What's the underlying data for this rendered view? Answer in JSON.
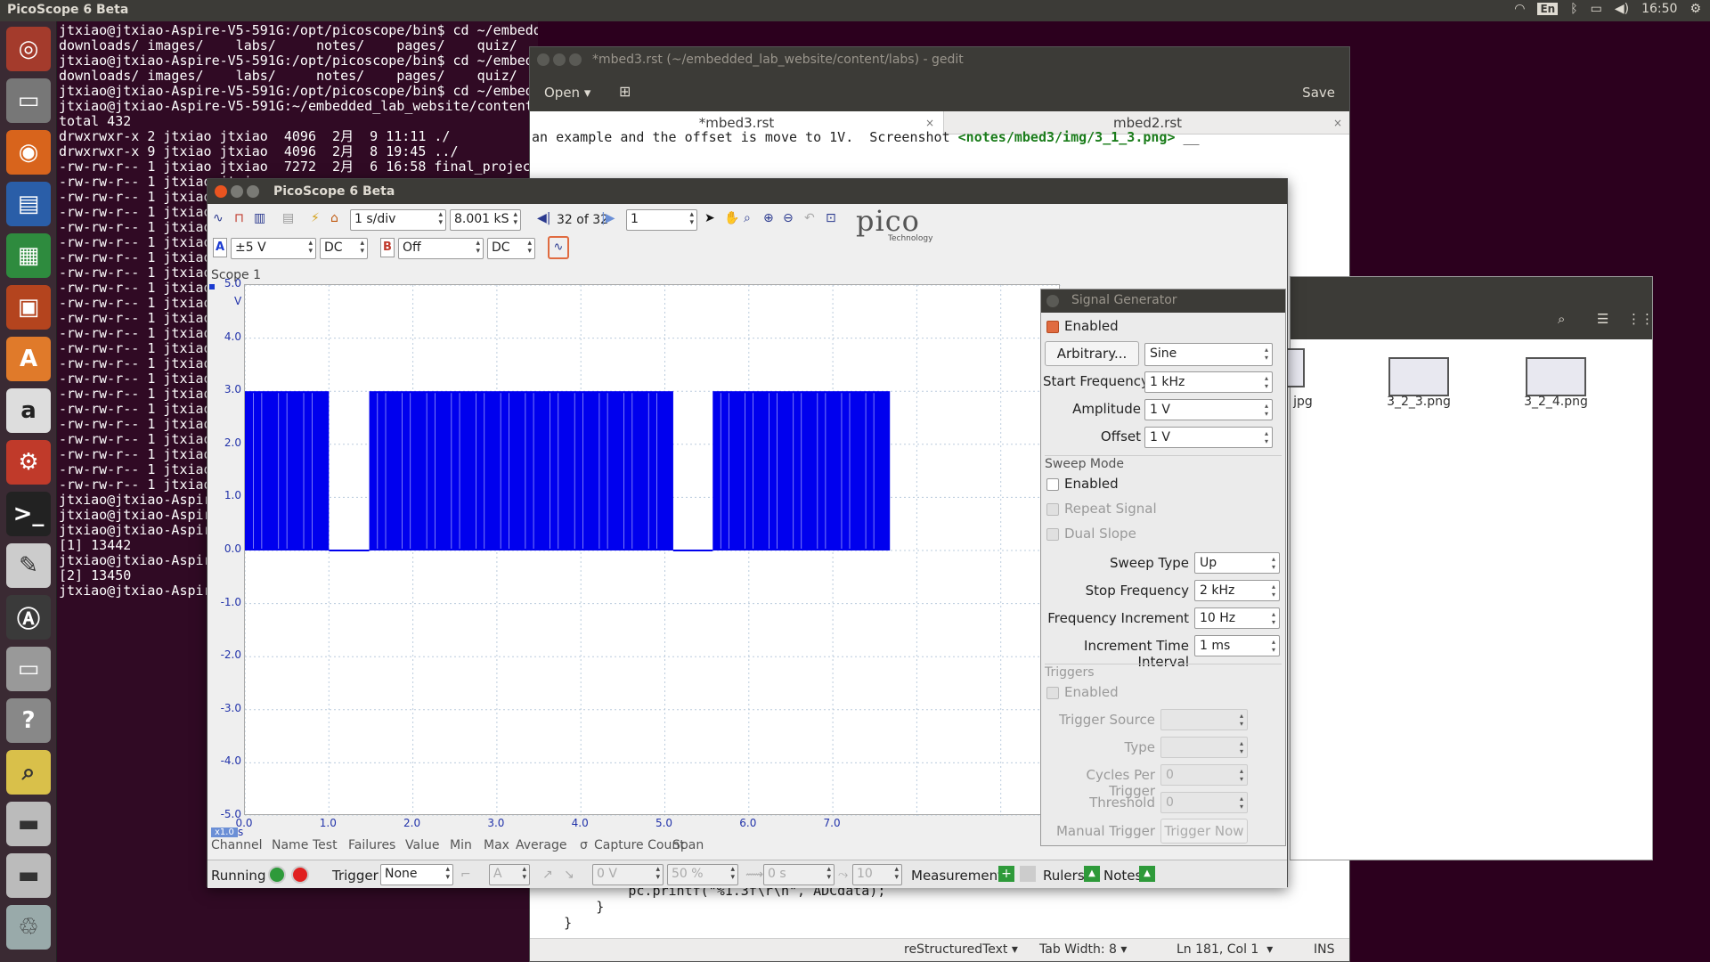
{
  "top_panel": {
    "title": "PicoScope 6 Beta",
    "keyboard": "En",
    "clock": "16:50"
  },
  "terminal": {
    "lines": [
      "jtxiao@jtxiao-Aspire-V5-591G:/opt/picoscope/bin$ cd ~/embedded_lab_website/content/",
      "downloads/ images/    labs/     notes/    pages/    quiz/     quiz_bank/",
      "jtxiao@jtxiao-Aspire-V5-591G:/opt/picoscope/bin$ cd ~/embedded_lab_website/content/",
      "downloads/ images/    labs/     notes/    pages/    quiz/",
      "jtxiao@jtxiao-Aspire-V5-591G:/opt/picoscope/bin$ cd ~/embedded_lab_website/content/labs/",
      "jtxiao@jtxiao-Aspire-V5-591G:~/embedded_lab_website/content/labs$ ls -l",
      "total 432",
      "drwxrwxr-x 2 jtxiao jtxiao  4096  2月  9 11:11 ./",
      "drwxrwxr-x 9 jtxiao jtxiao  4096  2月  8 19:45 ../",
      "-rw-rw-r-- 1 jtxiao jtxiao  7272  2月  6 16:58 final_project.rst",
      "-rw-rw-r-- 1 jtxiao jtxiao",
      "-rw-rw-r-- 1 jtxiao jtxiao",
      "-rw-rw-r-- 1 jtxiao jtxiao",
      "-rw-rw-r-- 1 jtxiao jtxiao",
      "-rw-rw-r-- 1 jtxiao jtxiao",
      "-rw-rw-r-- 1 jtxiao jtxiao",
      "-rw-rw-r-- 1 jtxiao jtxiao",
      "-rw-rw-r-- 1 jtxiao jtxiao",
      "-rw-rw-r-- 1 jtxiao jtxiao",
      "-rw-rw-r-- 1 jtxiao jtxiao",
      "-rw-rw-r-- 1 jtxiao jtxiao",
      "-rw-rw-r-- 1 jtxiao jtxiao",
      "-rw-rw-r-- 1 jtxiao jtxiao",
      "-rw-rw-r-- 1 jtxiao jtxiao",
      "-rw-rw-r-- 1 jtxiao jtxiao",
      "-rw-rw-r-- 1 jtxiao jtxiao",
      "-rw-rw-r-- 1 jtxiao jtxiao",
      "-rw-rw-r-- 1 jtxiao jtxiao",
      "-rw-rw-r-- 1 jtxiao jtxiao",
      "-rw-rw-r-- 1 jtxiao jtxiao",
      "-rw-rw-r-- 1 jtxiao jtxiao",
      "jtxiao@jtxiao-Aspire-V5-591G:",
      "jtxiao@jtxiao-Aspire-V5-591G:",
      "jtxiao@jtxiao-Aspire-V5-591G:",
      "[1] 13442",
      "jtxiao@jtxiao-Aspire-V5-591G:",
      "[2] 13450",
      "jtxiao@jtxiao-Aspire-V5-591G:"
    ]
  },
  "gedit": {
    "title": "*mbed3.rst (~/embedded_lab_website/content/labs) - gedit",
    "open_label": "Open",
    "save_label": "Save",
    "tab1": "*mbed3.rst",
    "tab2": "mbed2.rst",
    "code_top_a": "an example and the offset is move to 1V.  Screenshot ",
    "code_top_b": "<notes/mbed3/img/3_1_3.png>",
    "code_top_c": " __",
    "code_bottom1": "            pc.printf(\"%1.3f\\r\\n\", ADCdata);",
    "code_bottom2": "        }",
    "code_bottom3": "    }",
    "status_lang": "reStructuredText",
    "status_tab": "Tab Width: 8",
    "status_pos": "Ln 181, Col 1",
    "status_ins": "INS"
  },
  "files": {
    "items": [
      {
        "name": "jpg"
      },
      {
        "name": "3_2_3.png"
      },
      {
        "name": "3_2_4.png"
      }
    ]
  },
  "pico": {
    "title": "PicoScope 6 Beta",
    "timebase": "1 s/div",
    "samples": "8.001 kS",
    "buffer": "32 of 32",
    "capture_count": "1",
    "logo": "pico",
    "logo_sub": "Technology",
    "chA": {
      "label": "A",
      "range": "±5 V",
      "coupling": "DC"
    },
    "chB": {
      "label": "B",
      "range": "Off",
      "coupling": "DC"
    },
    "scope_label": "Scope 1",
    "x_unit": "s",
    "y_unit": "V",
    "zoom_badge": "x1.0",
    "meas_headers": [
      "Channel",
      "Name",
      "Test",
      "Failures",
      "Value",
      "Min",
      "Max",
      "Average",
      "σ",
      "Capture Count",
      "Span"
    ],
    "bottom": {
      "running": "Running",
      "trigger_label": "Trigger",
      "trigger_value": "None",
      "trig_ch": "A",
      "trig_level": "0 V",
      "trig_pct": "50 %",
      "trig_delay": "0 s",
      "trig_count": "10",
      "measurements": "Measurements",
      "rulers": "Rulers",
      "notes": "Notes"
    }
  },
  "chart_data": {
    "type": "line",
    "xlabel": "s",
    "ylabel": "V",
    "xlim": [
      0.0,
      8.0
    ],
    "ylim": [
      -5.0,
      5.0
    ],
    "x_ticks": [
      "0.0",
      "1.0",
      "2.0",
      "3.0",
      "4.0",
      "5.0",
      "6.0",
      "7.0"
    ],
    "y_ticks": [
      "5.0",
      "4.0",
      "3.0",
      "2.0",
      "1.0",
      "0.0",
      "-1.0",
      "-2.0",
      "-3.0",
      "-4.0",
      "-5.0"
    ],
    "grid": true,
    "series": [
      {
        "color": "#0000ee",
        "description_high_v": 3.0,
        "description_low_v": 0.0,
        "segments": [
          {
            "x0": 0.0,
            "x1": 1.0,
            "state": "toggling"
          },
          {
            "x0": 1.0,
            "x1": 1.48,
            "state": "low"
          },
          {
            "x0": 1.48,
            "x1": 5.1,
            "state": "toggling"
          },
          {
            "x0": 5.1,
            "x1": 5.57,
            "state": "low"
          },
          {
            "x0": 5.57,
            "x1": 7.68,
            "state": "toggling"
          }
        ]
      }
    ]
  },
  "signal_generator": {
    "title": "Signal Generator",
    "enabled_label": "Enabled",
    "enabled": true,
    "arbitrary_label": "Arbitrary...",
    "waveform": "Sine",
    "start_freq_label": "Start Frequency",
    "start_freq": "1 kHz",
    "amplitude_label": "Amplitude",
    "amplitude": "1 V",
    "offset_label": "Offset",
    "offset": "1 V",
    "sweep_mode_label": "Sweep Mode",
    "sweep_enabled_label": "Enabled",
    "repeat_label": "Repeat Signal",
    "dual_slope_label": "Dual Slope",
    "sweep_type_label": "Sweep Type",
    "sweep_type": "Up",
    "stop_freq_label": "Stop Frequency",
    "stop_freq": "2 kHz",
    "freq_inc_label": "Frequency Increment",
    "freq_inc": "10 Hz",
    "inc_interval_label": "Increment Time Interval",
    "inc_interval": "1 ms",
    "triggers_label": "Triggers",
    "trig_enabled_label": "Enabled",
    "trig_source_label": "Trigger Source",
    "type_label": "Type",
    "cycles_label": "Cycles Per Trigger",
    "cycles": "0",
    "threshold_label": "Threshold",
    "threshold": "0",
    "manual_label": "Manual Trigger",
    "trigger_now_label": "Trigger Now"
  }
}
